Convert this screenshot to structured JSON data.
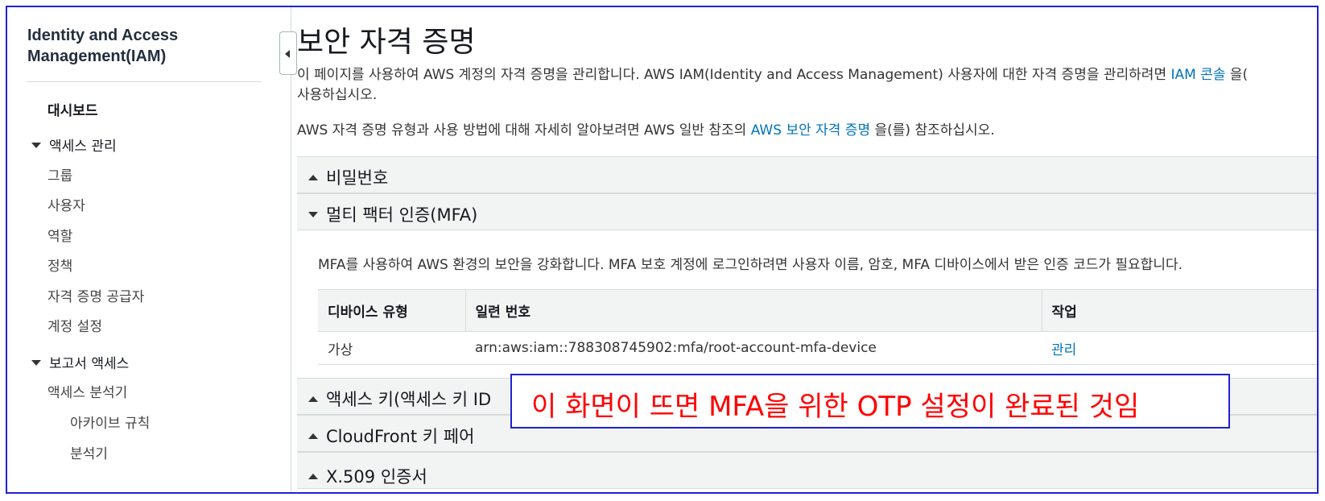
{
  "sidebar": {
    "title_line1": "Identity and Access",
    "title_line2": "Management(IAM)",
    "dashboard": "대시보드",
    "access_mgmt": "액세스 관리",
    "groups": "그룹",
    "users": "사용자",
    "roles": "역할",
    "policies": "정책",
    "identity_providers": "자격 증명 공급자",
    "account_settings": "계정 설정",
    "reports": "보고서 액세스",
    "access_analyzer": "액세스 분석기",
    "archive_rules": "아카이브 규칙",
    "analyzers": "분석기"
  },
  "main": {
    "title": "보안 자격 증명",
    "desc1_a": "이 페이지를 사용하여 AWS 계정의 자격 증명을 관리합니다. AWS IAM(Identity and Access Management) 사용자에 대한 자격 증명을 관리하려면 ",
    "desc1_link": "IAM 콘솔",
    "desc1_b": " 을(",
    "desc1_line2": "사용하십시오.",
    "desc2_a": "AWS 자격 증명 유형과 사용 방법에 대해 자세히 알아보려면 AWS 일반 참조의 ",
    "desc2_link": "AWS 보안 자격 증명",
    "desc2_b": " 을(를) 참조하십시오.",
    "sections": {
      "password": "비밀번호",
      "mfa": "멀티 팩터 인증(MFA)",
      "access_keys": "액세스 키(액세스 키 ID",
      "cloudfront": "CloudFront 키 페어",
      "x509": "X.509 인증서"
    },
    "mfa_desc": "MFA를 사용하여 AWS 환경의 보안을 강화합니다. MFA 보호 계정에 로그인하려면 사용자 이름, 암호, MFA 디바이스에서 받은 인증 코드가 필요합니다.",
    "table": {
      "headers": [
        "디바이스 유형",
        "일련 번호",
        "작업"
      ],
      "row": {
        "type": "가상",
        "serial": "arn:aws:iam::788308745902:mfa/root-account-mfa-device",
        "action": "관리"
      }
    }
  },
  "annotation": "이 화면이 뜨면 MFA을 위한 OTP 설정이 완료된 것임"
}
